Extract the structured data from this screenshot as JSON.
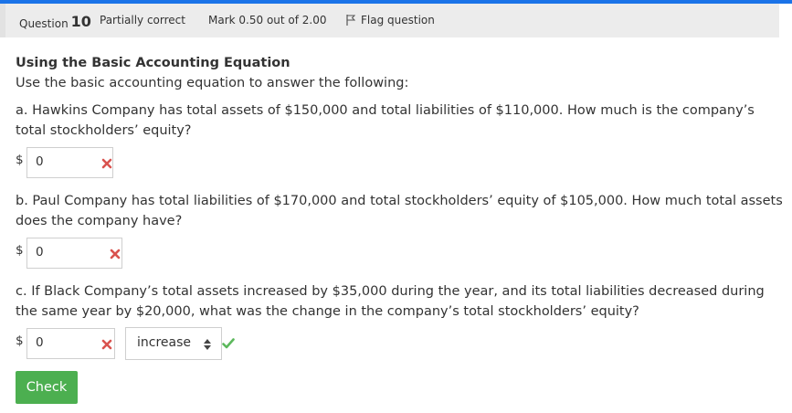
{
  "header": {
    "question_prefix": "Question",
    "question_number": "10",
    "status": "Partially correct",
    "mark": "Mark 0.50 out of 2.00",
    "flag_label": "Flag question"
  },
  "question": {
    "title": "Using the Basic Accounting Equation",
    "intro": "Use the basic accounting equation to answer the following:",
    "parts": [
      {
        "text": "a. Hawkins Company has total assets of $150,000 and total liabilities of $110,000. How much is the company’s total stockholders’ equity?",
        "currency": "$",
        "value": "0",
        "result": "incorrect"
      },
      {
        "text": "b. Paul Company has total liabilities of $170,000 and total stockholders’ equity of $105,000. How much total assets does the company have?",
        "currency": "$",
        "value": "0",
        "result": "incorrect"
      },
      {
        "text": "c. If Black Company’s total assets increased by $35,000 during the year, and its total liabilities decreased during the same year by $20,000, what was the change in the company’s total stockholders’ equity?",
        "currency": "$",
        "value": "0",
        "result": "incorrect",
        "select_value": "increase",
        "select_result": "correct"
      }
    ]
  },
  "check_button": "Check",
  "colors": {
    "accent": "#1a73e8",
    "incorrect": "#d9534f",
    "correct": "#5cb85c",
    "button": "#4caf50"
  }
}
